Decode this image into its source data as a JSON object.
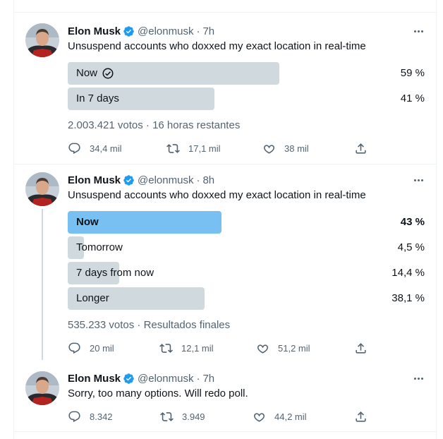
{
  "tweets": [
    {
      "name": "Elon Musk",
      "handle": "@elonmusk",
      "sep": "·",
      "time": "7h",
      "text": "Unsuspend accounts who doxxed my exact location in real-time",
      "poll": {
        "options": [
          {
            "label": "Now",
            "pct": "59 %",
            "fraction": 0.59,
            "winner": false,
            "bold": false,
            "voted": true
          },
          {
            "label": "In 7 days",
            "pct": "41 %",
            "fraction": 0.41,
            "winner": false,
            "bold": false,
            "voted": false
          }
        ],
        "meta": "2.003.421 votos · 16 horas restantes"
      },
      "actions": {
        "reply": "34,4 mil",
        "retweet": "17,1 mil",
        "like": "38 mil"
      }
    },
    {
      "name": "Elon Musk",
      "handle": "@elonmusk",
      "sep": "·",
      "time": "8h",
      "text": "Unsuspend accounts who doxxed my exact location in real-time",
      "poll": {
        "options": [
          {
            "label": "Now",
            "pct": "43 %",
            "fraction": 0.43,
            "winner": true,
            "bold": true,
            "voted": false
          },
          {
            "label": "Tomorrow",
            "pct": "4,5 %",
            "fraction": 0.045,
            "winner": false,
            "bold": false,
            "voted": false
          },
          {
            "label": "7 days from now",
            "pct": "14,4 %",
            "fraction": 0.144,
            "winner": false,
            "bold": false,
            "voted": false
          },
          {
            "label": "Longer",
            "pct": "38,1 %",
            "fraction": 0.381,
            "winner": false,
            "bold": false,
            "voted": false
          }
        ],
        "meta": "535.233 votos · Resultados finales"
      },
      "actions": {
        "reply": "20 mil",
        "retweet": "12,1 mil",
        "like": "51,2 mil"
      }
    },
    {
      "name": "Elon Musk",
      "handle": "@elonmusk",
      "sep": "·",
      "time": "7h",
      "text": "Sorry, too many options. Will redo poll.",
      "actions": {
        "reply": "8.342",
        "retweet": "3.949",
        "like": "44,2 mil"
      }
    }
  ],
  "colors": {
    "accent": "#1d9bf0",
    "poll_bar": "#cfd9de",
    "poll_winner": "#79c0f2",
    "muted": "#536471"
  }
}
